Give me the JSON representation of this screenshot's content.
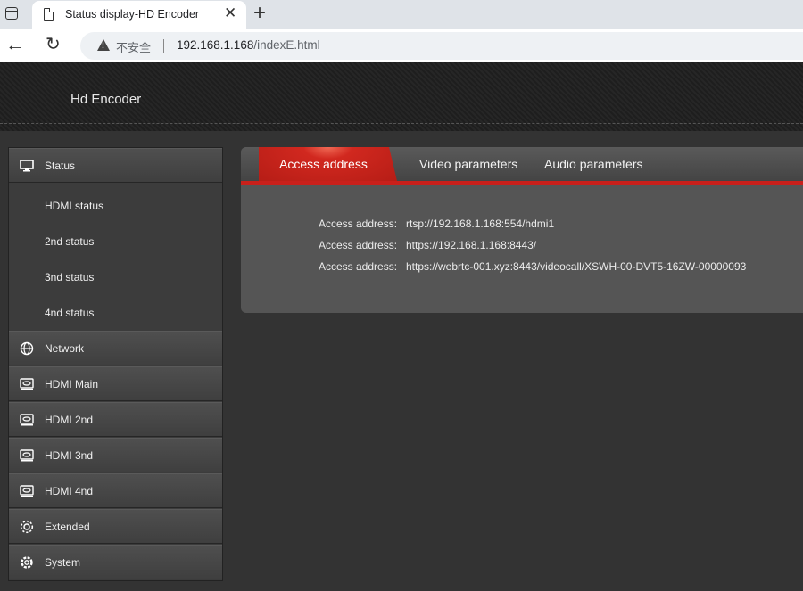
{
  "browser": {
    "tab_title": "Status display-HD Encoder",
    "tab_close": "✕",
    "new_tab": "+",
    "security_label": "不安全",
    "url_host": "192.168.1.168",
    "url_path": "/indexE.html"
  },
  "header": {
    "title": "Hd Encoder"
  },
  "sidebar": {
    "status": "Status",
    "sub_items": [
      "HDMI status",
      "2nd status",
      "3nd status",
      "4nd status"
    ],
    "items": [
      {
        "label": "Network",
        "icon": "globe-icon"
      },
      {
        "label": "HDMI Main",
        "icon": "hdmi-icon"
      },
      {
        "label": "HDMI 2nd",
        "icon": "hdmi-icon"
      },
      {
        "label": "HDMI 3nd",
        "icon": "hdmi-icon"
      },
      {
        "label": "HDMI 4nd",
        "icon": "hdmi-icon"
      },
      {
        "label": "Extended",
        "icon": "gear-icon"
      },
      {
        "label": "System",
        "icon": "settings-icon"
      }
    ]
  },
  "tabs": {
    "active": "Access address",
    "video": "Video parameters",
    "audio": "Audio parameters"
  },
  "access": [
    {
      "key": "Access address:",
      "value": "rtsp://192.168.1.168:554/hdmi1"
    },
    {
      "key": "Access address:",
      "value": "https://192.168.1.168:8443/"
    },
    {
      "key": "Access address:",
      "value": "https://webrtc-001.xyz:8443/videocall/XSWH-00-DVT5-16ZW-00000093"
    }
  ],
  "colors": {
    "accent": "#c9201b",
    "panel": "#555555",
    "background": "#333333"
  }
}
